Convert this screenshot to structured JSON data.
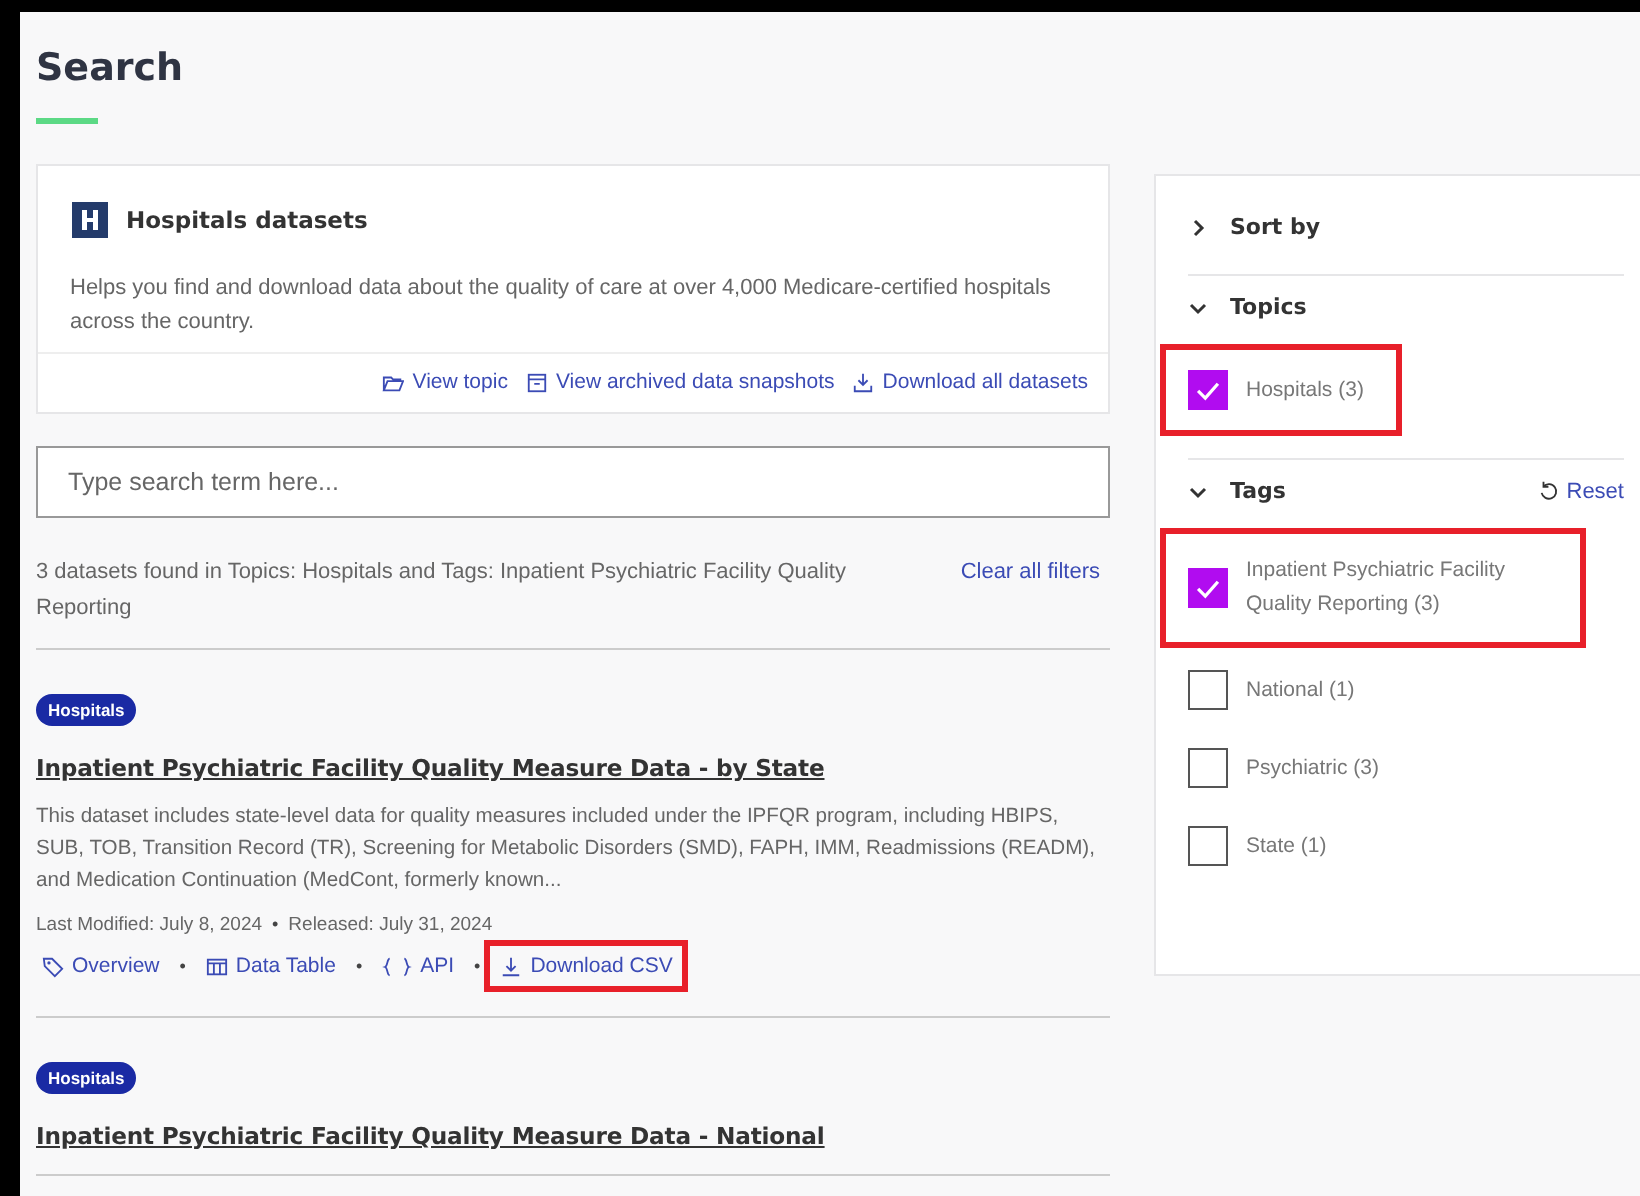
{
  "page_title": "Search",
  "topic_card": {
    "title": "Hospitals datasets",
    "description": "Helps you find and download data about the quality of care at over 4,000 Medicare-certified hospitals across the country.",
    "links": [
      {
        "kind": "folder",
        "label": "View topic"
      },
      {
        "kind": "archive",
        "label": "View archived data snapshots"
      },
      {
        "kind": "download",
        "label": "Download all datasets"
      }
    ]
  },
  "search": {
    "placeholder": "Type search term here..."
  },
  "result_summary": "3 datasets found in Topics: Hospitals and Tags: Inpatient Psychiatric Facility Quality Reporting",
  "clear_filters": "Clear all filters",
  "results": [
    {
      "tag": "Hospitals",
      "title": "Inpatient Psychiatric Facility Quality Measure Data - by State",
      "description": "This dataset includes state-level data for quality measures included under the IPFQR program, including HBIPS, SUB, TOB, Transition Record (TR), Screening for Metabolic Disorders (SMD), FAPH, IMM, Readmissions (READM), and Medication Continuation (MedCont, formerly known...",
      "meta": [
        {
          "text": "Last Modified: July 8, 2024"
        },
        {
          "separator": "•",
          "text": "Released: July 31, 2024"
        }
      ],
      "links": [
        {
          "kind": "tag",
          "label": "Overview",
          "highlighted": false
        },
        {
          "kind": "table",
          "separator": "•",
          "label": "Data Table",
          "highlighted": false
        },
        {
          "kind": "braces",
          "separator": "•",
          "label": "API",
          "highlighted": false
        },
        {
          "kind": "download",
          "separator": "•",
          "label": "Download CSV",
          "highlighted": true
        }
      ]
    },
    {
      "tag": "Hospitals",
      "title": "Inpatient Psychiatric Facility Quality Measure Data - National"
    }
  ],
  "filters": {
    "sections": [
      {
        "title": "Sort by",
        "expanded": false
      },
      {
        "title": "Topics",
        "expanded": true,
        "items": [
          {
            "label": "Hospitals (3)",
            "checked": true,
            "highlighted": true
          }
        ]
      },
      {
        "title": "Tags",
        "expanded": true,
        "reset": "Reset",
        "items": [
          {
            "label": "Inpatient Psychiatric Facility Quality Reporting (3)",
            "checked": true,
            "highlighted": true
          },
          {
            "label": "National (1)",
            "checked": false,
            "highlighted": false
          },
          {
            "label": "Psychiatric (3)",
            "checked": false,
            "highlighted": false
          },
          {
            "label": "State (1)",
            "checked": false,
            "highlighted": false
          }
        ]
      }
    ]
  }
}
